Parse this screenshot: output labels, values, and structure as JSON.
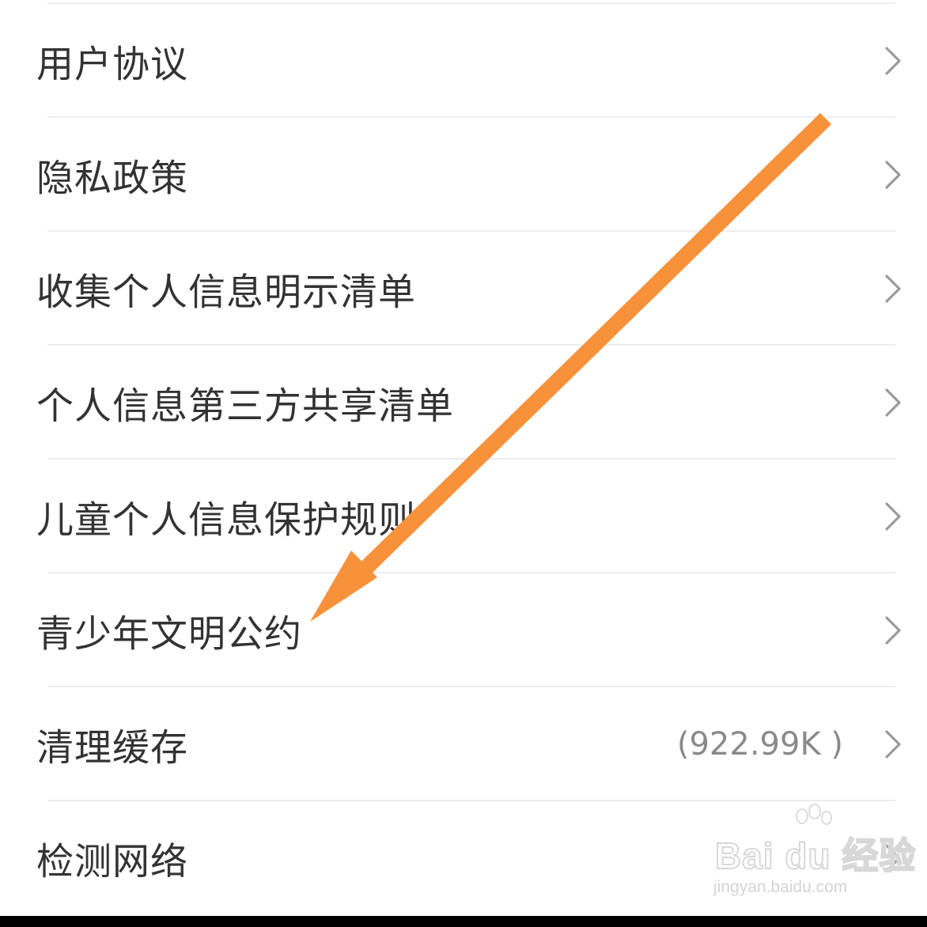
{
  "menu": {
    "items": [
      {
        "label": "用户协议",
        "value": ""
      },
      {
        "label": "隐私政策",
        "value": ""
      },
      {
        "label": "收集个人信息明示清单",
        "value": ""
      },
      {
        "label": "个人信息第三方共享清单",
        "value": ""
      },
      {
        "label": "儿童个人信息保护规则",
        "value": ""
      },
      {
        "label": "青少年文明公约",
        "value": ""
      },
      {
        "label": "清理缓存",
        "value": "(922.99K )"
      },
      {
        "label": "检测网络",
        "value": ""
      }
    ]
  },
  "icons": {
    "chevron": "chevron-right-icon",
    "annotation": "orange-arrow-annotation"
  },
  "colors": {
    "arrow": "#f7913a",
    "label_text": "#333333",
    "value_text": "#8a8a8a",
    "chevron": "#9a9a9a",
    "divider": "#ededed"
  },
  "watermark": {
    "logo_text": "Bai du 经验",
    "domain": "jingyan.baidu.com"
  }
}
